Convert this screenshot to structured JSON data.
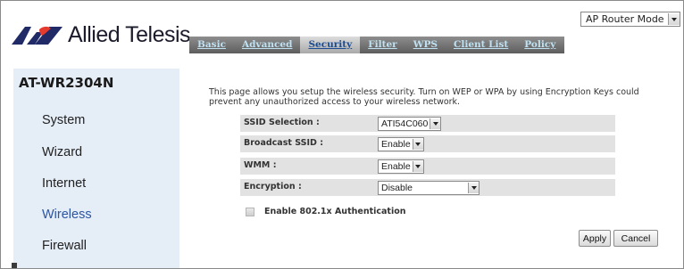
{
  "header": {
    "mode_select": {
      "value": "AP Router Mode"
    },
    "logo": {
      "text": "Allied Telesis",
      "colors": {
        "mark": "#1f2a67",
        "accent": "#e53b2e"
      }
    }
  },
  "tabs": [
    {
      "label": "Basic",
      "active": false
    },
    {
      "label": "Advanced",
      "active": false
    },
    {
      "label": "Security",
      "active": true
    },
    {
      "label": "Filter",
      "active": false
    },
    {
      "label": "WPS",
      "active": false
    },
    {
      "label": "Client List",
      "active": false
    },
    {
      "label": "Policy",
      "active": false
    }
  ],
  "sidebar": {
    "model": "AT-WR2304N",
    "items": [
      {
        "label": "System",
        "active": false
      },
      {
        "label": "Wizard",
        "active": false
      },
      {
        "label": "Internet",
        "active": false
      },
      {
        "label": "Wireless",
        "active": true
      },
      {
        "label": "Firewall",
        "active": false
      }
    ]
  },
  "content": {
    "intro": "This page allows you setup the wireless security. Turn on WEP or WPA by using Encryption Keys could prevent any unauthorized access to your wireless network.",
    "fields": {
      "ssid_selection": {
        "label": "SSID Selection :",
        "value": "ATI54C060"
      },
      "broadcast_ssid": {
        "label": "Broadcast SSID :",
        "value": "Enable"
      },
      "wmm": {
        "label": "WMM :",
        "value": "Enable"
      },
      "encryption": {
        "label": "Encryption :",
        "value": "Disable"
      }
    },
    "auth_checkbox": {
      "label": "Enable 802.1x Authentication",
      "checked": false
    },
    "buttons": {
      "apply": "Apply",
      "cancel": "Cancel"
    }
  },
  "colors": {
    "tab_link": "#bfe1f2",
    "active_nav": "#2c55a3",
    "sidebar_bg": "#e5edf7",
    "row_bg": "#e2e2e2"
  }
}
